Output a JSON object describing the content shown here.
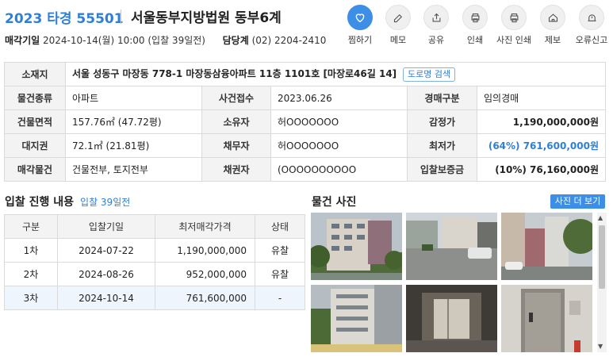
{
  "header": {
    "case_number": "2023 타경 55501",
    "court": "서울동부지방법원 동부6계",
    "sale_date_label": "매각기일",
    "sale_date_value": "2024-10-14(월) 10:00 (입찰 39일전)",
    "dept_label": "담당계",
    "dept_phone": "(02) 2204-2410"
  },
  "actions": [
    {
      "label": "찜하기",
      "icon": "heart-icon"
    },
    {
      "label": "메모",
      "icon": "edit-icon"
    },
    {
      "label": "공유",
      "icon": "share-icon"
    },
    {
      "label": "인쇄",
      "icon": "print-icon"
    },
    {
      "label": "사진 인쇄",
      "icon": "print-icon"
    },
    {
      "label": "제보",
      "icon": "home-icon"
    },
    {
      "label": "오류신고",
      "icon": "alert-icon"
    }
  ],
  "info": {
    "address_label": "소재지",
    "address_value": "서울 성동구 마장동 778-1 마장동삼융아파트 11층 1101호 [마장로46길 14]",
    "road_search_button": "도로명 검색",
    "type_label": "물건종류",
    "type_value": "아파트",
    "filed_label": "사건접수",
    "filed_value": "2023.06.26",
    "auction_kind_label": "경매구분",
    "auction_kind_value": "임의경매",
    "building_area_label": "건물면적",
    "building_area_value": "157.76㎡ (47.72평)",
    "owner_label": "소유자",
    "owner_value": "허OOOOOOO",
    "appraisal_label": "감정가",
    "appraisal_value": "1,190,000,000원",
    "land_right_label": "대지권",
    "land_right_value": "72.1㎡ (21.81평)",
    "debtor_label": "채무자",
    "debtor_value": "허OOOOOOO",
    "min_price_label": "최저가",
    "min_price_value": "(64%) 761,600,000원",
    "sale_object_label": "매각물건",
    "sale_object_value": "건물전부, 토지전부",
    "creditor_label": "채권자",
    "creditor_value": "(OOOOOOOOOO",
    "deposit_label": "입찰보증금",
    "deposit_value": "(10%) 76,160,000원"
  },
  "bids": {
    "title": "입찰 진행 내용",
    "subtitle": "입찰 39일전",
    "columns": [
      "구분",
      "입찰기일",
      "최저매각가격",
      "상태"
    ],
    "rows": [
      {
        "round": "1차",
        "date": "2024-07-22",
        "price": "1,190,000,000",
        "status": "유찰"
      },
      {
        "round": "2차",
        "date": "2024-08-26",
        "price": "952,000,000",
        "status": "유찰"
      },
      {
        "round": "3차",
        "date": "2024-10-14",
        "price": "761,600,000",
        "status": "-"
      }
    ]
  },
  "photos": {
    "title": "물건 사진",
    "more_button": "사진 더 보기"
  }
}
